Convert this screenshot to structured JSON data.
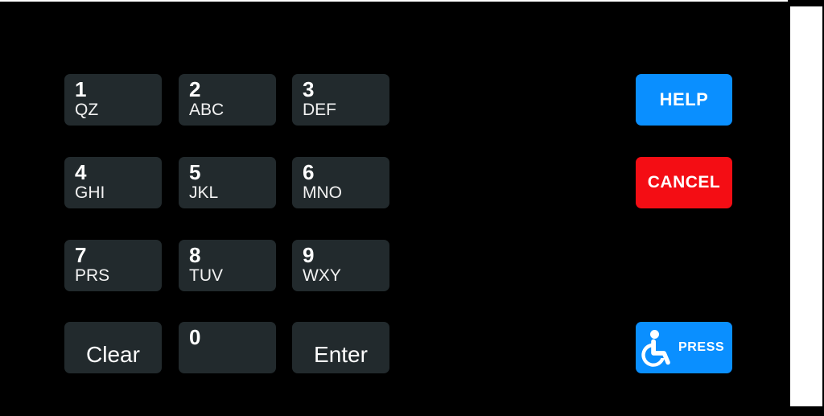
{
  "device": {
    "name": "fuel-dispenser-pinpad",
    "background_color": "#000000",
    "accent_blue": "#0a8fff",
    "accent_red": "#f40d14",
    "key_fill": "#222a2d",
    "key_text": "#ffffff",
    "bezel_strip_color": "#ffffff"
  },
  "keypad": {
    "keys": [
      {
        "digit": "1",
        "letters": "QZ",
        "name": "key-1"
      },
      {
        "digit": "2",
        "letters": "ABC",
        "name": "key-2"
      },
      {
        "digit": "3",
        "letters": "DEF",
        "name": "key-3"
      },
      {
        "digit": "4",
        "letters": "GHI",
        "name": "key-4"
      },
      {
        "digit": "5",
        "letters": "JKL",
        "name": "key-5"
      },
      {
        "digit": "6",
        "letters": "MNO",
        "name": "key-6"
      },
      {
        "digit": "7",
        "letters": "PRS",
        "name": "key-7"
      },
      {
        "digit": "8",
        "letters": "TUV",
        "name": "key-8"
      },
      {
        "digit": "9",
        "letters": "WXY",
        "name": "key-9"
      },
      {
        "digit": "0",
        "letters": "",
        "name": "key-0"
      }
    ],
    "clear_label": "Clear",
    "enter_label": "Enter"
  },
  "side_buttons": {
    "help_label": "HELP",
    "cancel_label": "CANCEL",
    "accessibility_label": "PRESS",
    "accessibility_icon": "wheelchair-icon"
  }
}
